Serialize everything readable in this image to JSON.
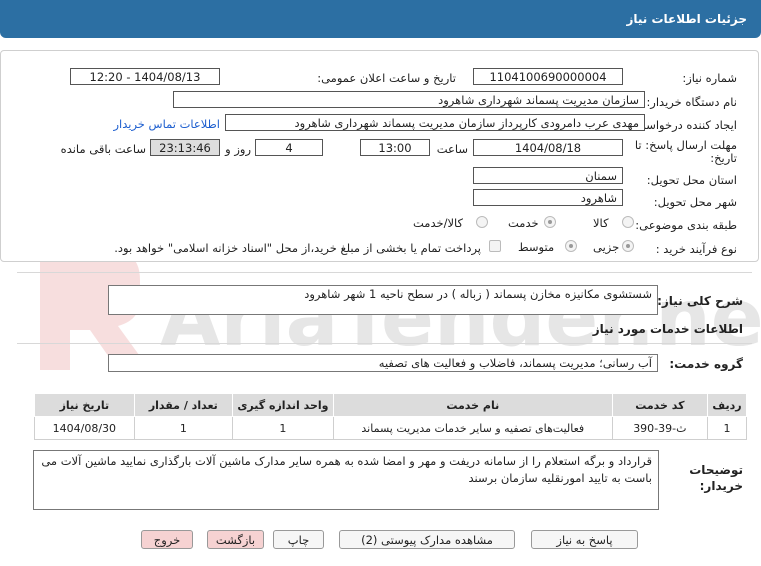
{
  "header": {
    "title": "جزئیات اطلاعات نیاز"
  },
  "form": {
    "need_number": {
      "label": "شماره نیاز:",
      "value": "1104100690000004"
    },
    "announce": {
      "label": "تاریخ و ساعت اعلان عمومی:",
      "value": "1404/08/13 - 12:20"
    },
    "buyer_org": {
      "label": "نام دستگاه خریدار:",
      "value": "سازمان مدیریت پسماند شهرداری شاهرود"
    },
    "creator": {
      "label": "ایجاد کننده درخواست:",
      "value": "مهدی عرب دامرودی کارپرداز سازمان مدیریت پسماند شهرداری شاهرود",
      "contact_link": "اطلاعات تماس خریدار"
    },
    "deadline": {
      "label": "مهلت ارسال پاسخ: تا تاریخ:",
      "date": "1404/08/18",
      "time_label": "ساعت",
      "time": "13:00",
      "days": "4",
      "days_label": "روز و",
      "remaining": "23:13:46",
      "remaining_label": "ساعت باقی مانده"
    },
    "province": {
      "label": "استان محل تحویل:",
      "value": "سمنان"
    },
    "city": {
      "label": "شهر محل تحویل:",
      "value": "شاهرود"
    },
    "category": {
      "label": "طبقه بندی موضوعی:",
      "options": [
        "کالا",
        "خدمت",
        "کالا/خدمت"
      ],
      "selected": "خدمت"
    },
    "process": {
      "label": "نوع فرآیند خرید :",
      "options": [
        "جزیی",
        "متوسط"
      ],
      "selected": "جزیی",
      "payment_note": "پرداخت تمام یا بخشی از مبلغ خرید،از محل \"اسناد خزانه اسلامی\" خواهد بود."
    }
  },
  "description": {
    "label": "شرح کلی نیاز:",
    "value": "شستشوی  مکانیزه مخازن پسماند ( زباله ) در سطح ناحیه 1 شهر شاهرود"
  },
  "services_section": {
    "title": "اطلاعات خدمات مورد نیاز"
  },
  "service_group": {
    "label": "گروه خدمت:",
    "value": "آب رسانی؛ مدیریت پسماند، فاضلاب و فعالیت های تصفیه"
  },
  "table": {
    "headers": [
      "ردیف",
      "کد خدمت",
      "نام خدمت",
      "واحد اندازه گیری",
      "تعداد / مقدار",
      "تاریخ نیاز"
    ],
    "rows": [
      [
        "1",
        "ث-39-390",
        "فعالیت‌های تصفیه و سایر خدمات مدیریت پسماند",
        "1",
        "1",
        "1404/08/30"
      ]
    ]
  },
  "buyer_notes": {
    "label": "توضیحات خریدار:",
    "value": "قرارداد و برگه استعلام را از سامانه دریفت و مهر و امضا شده به همره سایر مدارک ماشین آلات بارگذاری نمایید ماشین آلات می باست به تایید امورنقلیه سازمان برسند"
  },
  "buttons": {
    "reply": "پاسخ به نیاز",
    "attachments": "مشاهده مدارک پیوستی (2)",
    "print": "چاپ",
    "back": "بازگشت",
    "exit": "خروج"
  },
  "watermark": {
    "text": "AriaTender.net"
  },
  "colors": {
    "header_bg": "#2c6fa3",
    "link": "#1e5fcf",
    "pink_button": "#f6d2d2",
    "table_header": "#dcdcdc"
  }
}
